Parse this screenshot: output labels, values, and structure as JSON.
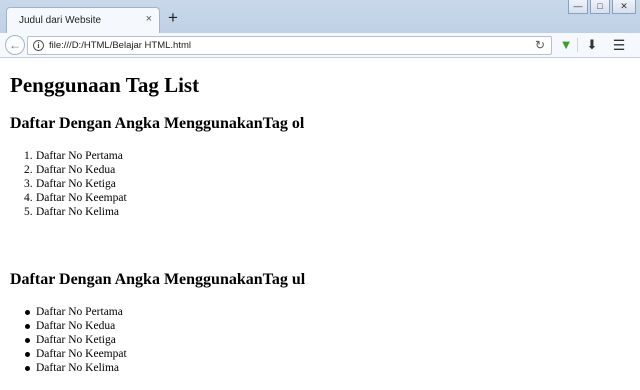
{
  "browser": {
    "tab_title": "Judul dari Website",
    "tab_close": "×",
    "new_tab": "+",
    "url": "file:///D:/HTML/Belajar HTML.html",
    "window_buttons": [
      "—",
      "□",
      "✕"
    ]
  },
  "page": {
    "heading": "Penggunaan Tag List",
    "section_ol": {
      "heading": "Daftar Dengan Angka MenggunakanTag ol",
      "items": [
        {
          "num": "1.",
          "text": "Daftar No Pertama"
        },
        {
          "num": "2.",
          "text": "Daftar No Kedua"
        },
        {
          "num": "3.",
          "text": "Daftar No Ketiga"
        },
        {
          "num": "4.",
          "text": "Daftar No Keempat"
        },
        {
          "num": "5.",
          "text": "Daftar No Kelima"
        }
      ]
    },
    "section_ul": {
      "heading": "Daftar Dengan Angka MenggunakanTag ul",
      "items": [
        {
          "text": "Daftar No Pertama"
        },
        {
          "text": "Daftar No Kedua"
        },
        {
          "text": "Daftar No Ketiga"
        },
        {
          "text": "Daftar No Keempat"
        },
        {
          "text": "Daftar No Kelima"
        }
      ]
    }
  },
  "icons": {
    "back": "back-arrow-icon",
    "info": "info-icon",
    "reload": "reload-icon",
    "extension": "download-helper-icon",
    "download": "download-icon",
    "menu": "hamburger-menu-icon"
  },
  "colors": {
    "titlebar": "#c9d8ea",
    "toolbar": "#f5f8fc",
    "extension_green": "#3aa02b"
  }
}
